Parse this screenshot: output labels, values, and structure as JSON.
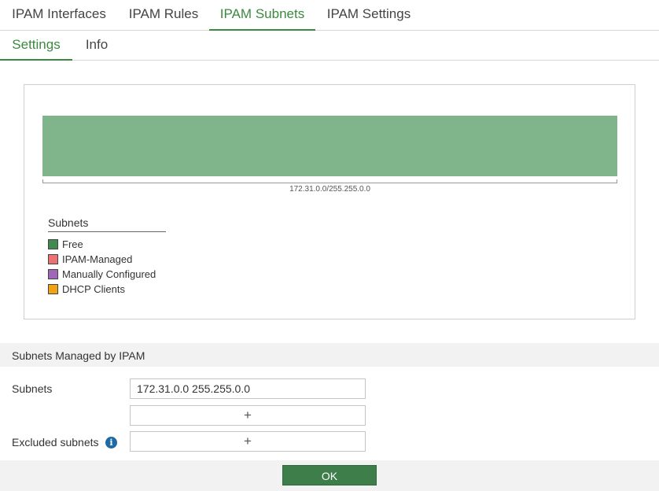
{
  "tabs": [
    {
      "label": "IPAM Interfaces",
      "active": false
    },
    {
      "label": "IPAM Rules",
      "active": false
    },
    {
      "label": "IPAM Subnets",
      "active": true
    },
    {
      "label": "IPAM Settings",
      "active": false
    }
  ],
  "subtabs": [
    {
      "label": "Settings",
      "active": true
    },
    {
      "label": "Info",
      "active": false
    }
  ],
  "viz": {
    "range_label": "172.31.0.0/255.255.0.0",
    "free_color": "#80b48b"
  },
  "legend": {
    "title": "Subnets",
    "items": [
      {
        "label": "Free",
        "color": "#3f8a50"
      },
      {
        "label": "IPAM-Managed",
        "color": "#ec7172"
      },
      {
        "label": "Manually Configured",
        "color": "#a066b8"
      },
      {
        "label": "DHCP Clients",
        "color": "#f2a315"
      }
    ]
  },
  "section": {
    "title": "Subnets Managed by IPAM"
  },
  "form": {
    "subnets_label": "Subnets",
    "subnets_value": "172.31.0.0 255.255.0.0",
    "add_symbol": "+",
    "excluded_label": "Excluded subnets",
    "info_icon": "info-icon"
  },
  "footer": {
    "ok_label": "OK"
  }
}
